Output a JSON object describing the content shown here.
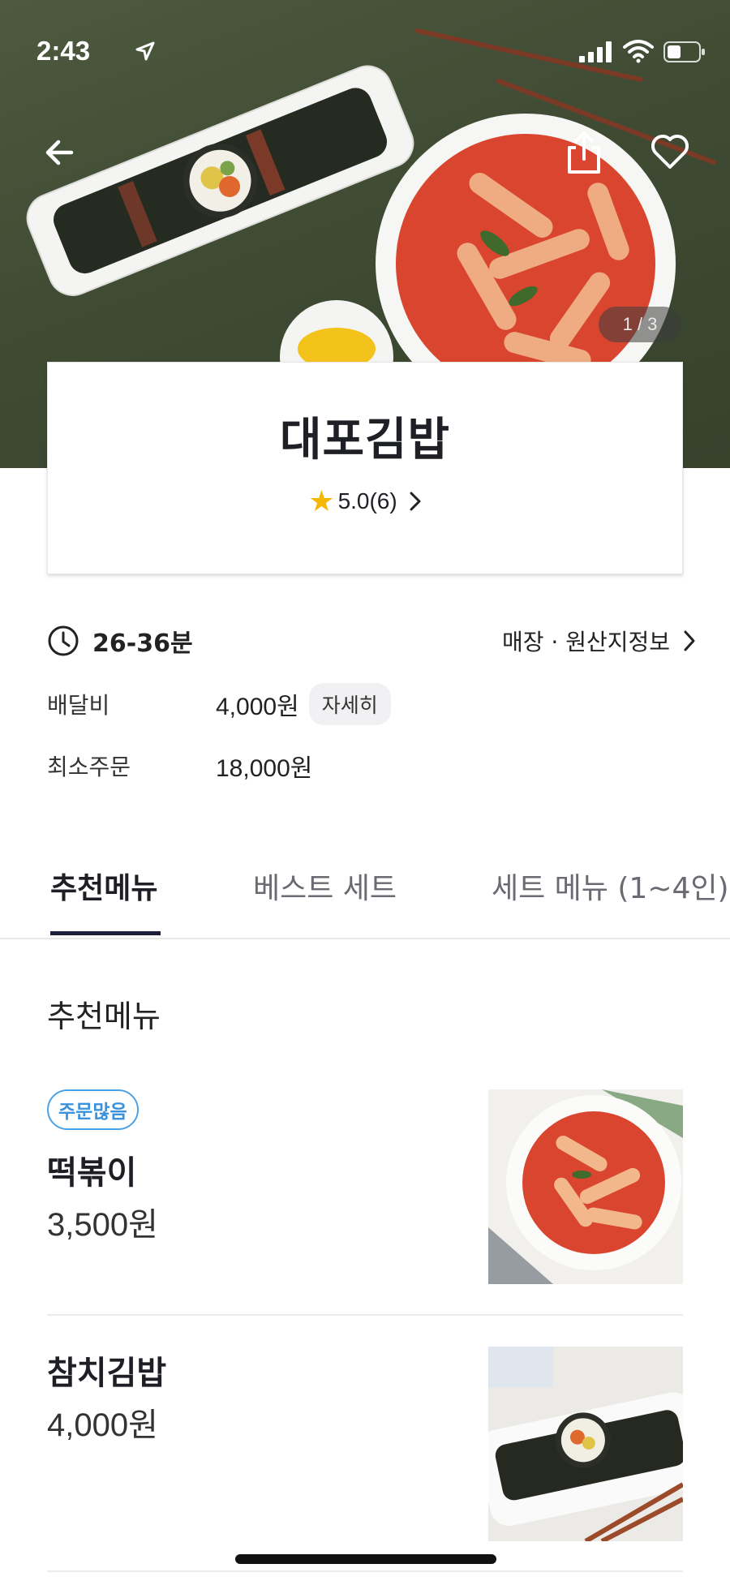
{
  "status_bar": {
    "time": "2:43"
  },
  "hero": {
    "pager": "1 / 3"
  },
  "store": {
    "name": "대포김밥",
    "rating": "5.0(6)"
  },
  "info": {
    "delivery_time": "26-36분",
    "store_info_link": "매장 · 원산지정보",
    "delivery_fee_label": "배달비",
    "delivery_fee_value": "4,000원",
    "detail_button": "자세히",
    "min_order_label": "최소주문",
    "min_order_value": "18,000원"
  },
  "tabs": [
    {
      "label": "추천메뉴",
      "active": true
    },
    {
      "label": "베스트 세트",
      "active": false
    },
    {
      "label": "세트 메뉴 (1~4인)",
      "active": false
    }
  ],
  "section": {
    "title": "추천메뉴"
  },
  "menu_items": [
    {
      "badge": "주문많음",
      "name": "떡볶이",
      "price": "3,500원"
    },
    {
      "badge": "",
      "name": "참치김밥",
      "price": "4,000원"
    }
  ],
  "colors": {
    "accent_blue": "#3a92dc",
    "star": "#f5b700",
    "tab_indicator": "#1e1e3a"
  },
  "icons": [
    "location-arrow-icon",
    "signal-icon",
    "wifi-icon",
    "battery-icon",
    "back-arrow-icon",
    "share-icon",
    "heart-icon",
    "star-icon",
    "clock-icon",
    "chevron-right-icon"
  ]
}
